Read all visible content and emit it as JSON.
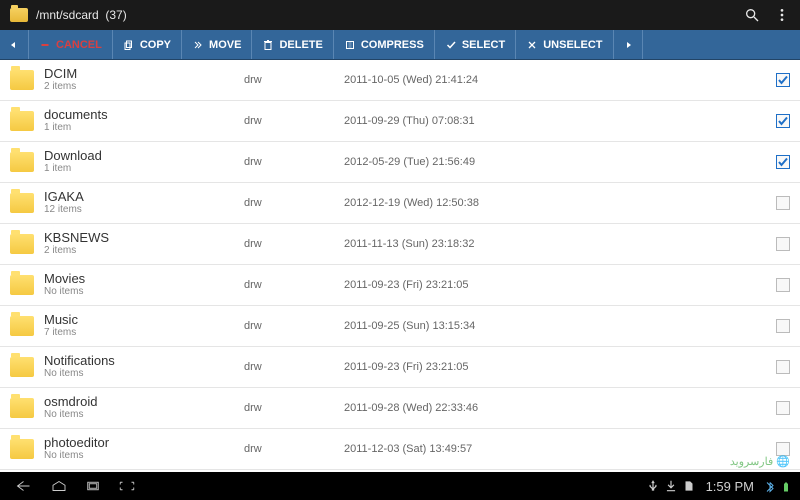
{
  "header": {
    "path": "/mnt/sdcard",
    "count": "(37)"
  },
  "toolbar": {
    "cancel": "CANCEL",
    "copy": "COPY",
    "move": "MOVE",
    "delete": "DELETE",
    "compress": "COMPRESS",
    "select": "SELECT",
    "unselect": "UNSELECT"
  },
  "files": [
    {
      "name": "DCIM",
      "sub": "2 items",
      "perm": "drw",
      "date": "2011-10-05 (Wed) 21:41:24",
      "checked": true
    },
    {
      "name": "documents",
      "sub": "1 item",
      "perm": "drw",
      "date": "2011-09-29 (Thu) 07:08:31",
      "checked": true
    },
    {
      "name": "Download",
      "sub": "1 item",
      "perm": "drw",
      "date": "2012-05-29 (Tue) 21:56:49",
      "checked": true
    },
    {
      "name": "IGAKA",
      "sub": "12 items",
      "perm": "drw",
      "date": "2012-12-19 (Wed) 12:50:38",
      "checked": false
    },
    {
      "name": "KBSNEWS",
      "sub": "2 items",
      "perm": "drw",
      "date": "2011-11-13 (Sun) 23:18:32",
      "checked": false
    },
    {
      "name": "Movies",
      "sub": "No items",
      "perm": "drw",
      "date": "2011-09-23 (Fri) 23:21:05",
      "checked": false
    },
    {
      "name": "Music",
      "sub": "7 items",
      "perm": "drw",
      "date": "2011-09-25 (Sun) 13:15:34",
      "checked": false
    },
    {
      "name": "Notifications",
      "sub": "No items",
      "perm": "drw",
      "date": "2011-09-23 (Fri) 23:21:05",
      "checked": false
    },
    {
      "name": "osmdroid",
      "sub": "No items",
      "perm": "drw",
      "date": "2011-09-28 (Wed) 22:33:46",
      "checked": false
    },
    {
      "name": "photoeditor",
      "sub": "No items",
      "perm": "drw",
      "date": "2011-12-03 (Sat) 13:49:57",
      "checked": false
    }
  ],
  "statusbar": {
    "time": "1:59 PM"
  },
  "watermark": "فارسروید"
}
